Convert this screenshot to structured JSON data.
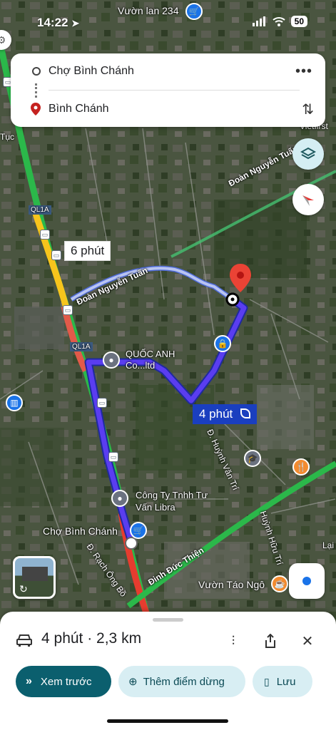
{
  "status_bar": {
    "time": "14:22",
    "battery": "50"
  },
  "search": {
    "origin": "Chợ Bình Chánh",
    "destination": "Bình Chánh"
  },
  "map": {
    "labels": {
      "vuon_lan": "Vườn lan 234",
      "vietfirst": "Vietfirst",
      "doan_nguyen_tuan_top": "Đoàn Nguyễn Tuấn",
      "doan_nguyen_tuan_left": "Đoàn Nguyễn Tuấn",
      "ql1a_top": "QL1A",
      "ql1a_mid": "QL1A",
      "quoc_anh": "QUỐC ANH Co...ltd",
      "huynh_van_tri": "Đ. Huỳnh Văn Trí",
      "huynh_huu_tri": "Huỳnh Hữu Trí",
      "cong_ty": "Công Ty Tnhh Tư Vấn Libra",
      "cho_binh_chanh": "Chợ Bình Chánh",
      "rach_ong_bo": "Đ. Rạch Ông Bồ",
      "dinh_duc_thien": "Đinh Đức Thiện",
      "vuon_tao": "Vườn Táo Ngô",
      "lai": "Lại",
      "tuc": "Tục"
    },
    "route_alt_time": "6 phút",
    "route_main_time": "4 phút"
  },
  "sheet": {
    "summary": "4 phút · 2,3 km",
    "preview_label": "Xem trước",
    "add_stop_label": "Thêm điểm dừng",
    "save_label": "Lưu"
  }
}
